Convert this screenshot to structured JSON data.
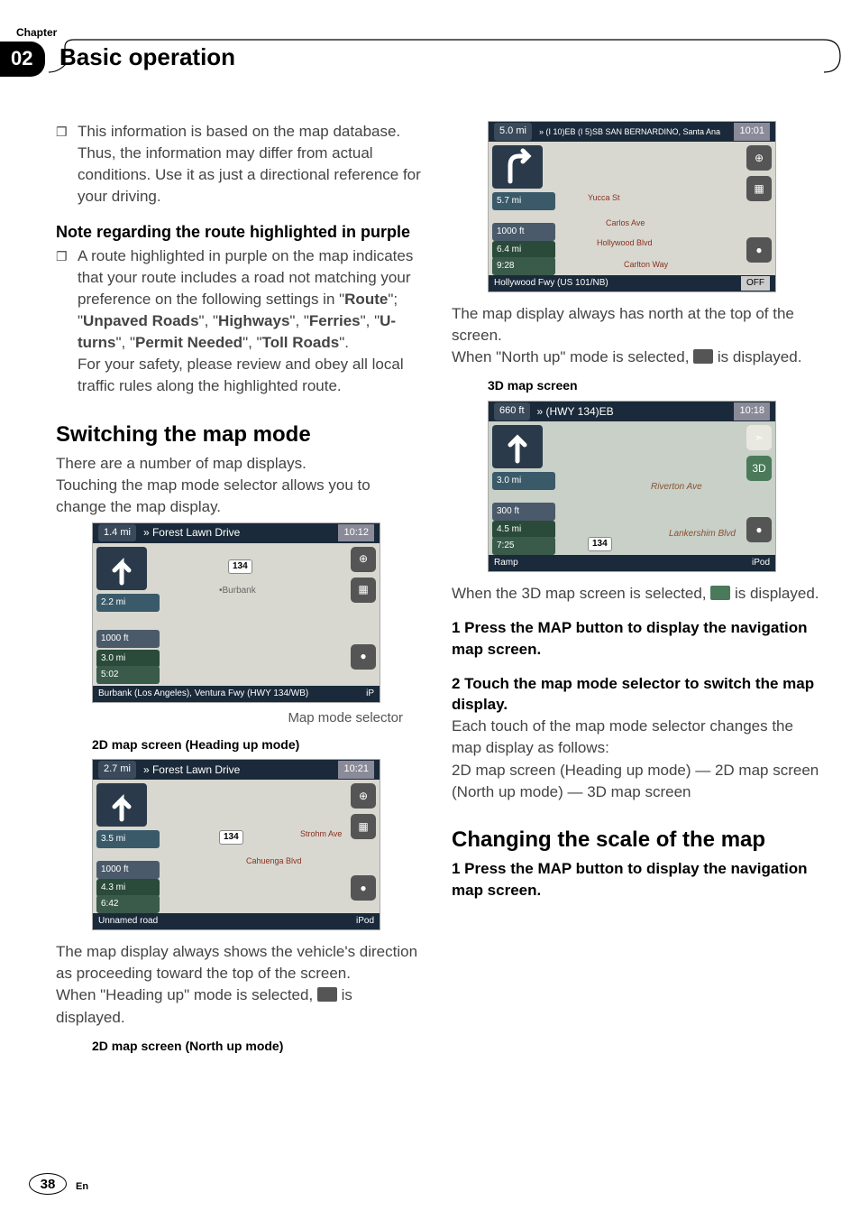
{
  "chapter_label": "Chapter",
  "chapter_num": "02",
  "chapter_title": "Basic operation",
  "bullet1": "This information is based on the map database. Thus, the information may differ from actual conditions. Use it as just a directional reference for your driving.",
  "subhead_purple": "Note regarding the route highlighted in purple",
  "bullet2_lead": "A route highlighted in purple on the map indicates that your route includes a road not matching your preference on the following settings in \"",
  "route_label": "Route",
  "mid_text": "\"; \"",
  "unpaved": "Unpaved Roads",
  "sep": "\", \"",
  "highways": "Highways",
  "ferries": "Ferries",
  "uturns": "U-turns",
  "permit": "Permit Needed",
  "toll": "Toll Roads",
  "end_quote": "\".",
  "safety": "For your safety, please review and obey all local traffic rules along the highlighted route.",
  "h2_switch": "Switching the map mode",
  "switch_p1": "There are a number of map displays.",
  "switch_p2": "Touching the map mode selector allows you to change the map display.",
  "map_mode_selector_caption": "Map mode selector",
  "caption_2d_heading": "2D map screen (Heading up mode)",
  "heading_up_desc": "The map display always shows the vehicle's direction as proceeding toward the top of the screen.",
  "heading_up_icon_pre": "When \"Heading up\" mode is selected, ",
  "heading_up_icon_post": " is displayed.",
  "caption_2d_north": "2D map screen (North up mode)",
  "north_up_desc": "The map display always has north at the top of the screen.",
  "north_up_icon_pre": "When \"North up\" mode is selected, ",
  "north_up_icon_post": " is displayed.",
  "caption_3d": "3D map screen",
  "threed_pre": "When the 3D map screen is selected, ",
  "threed_post": " is displayed.",
  "step1": "1    Press the MAP button to display the navigation map screen.",
  "step2": "2    Touch the map mode selector to switch the map display.",
  "step2_desc1": "Each touch of the map mode selector changes the map display as follows:",
  "step2_desc2": "2D map screen (Heading up mode) — 2D map screen (North up mode) — 3D map screen",
  "h2_scale": "Changing the scale of the map",
  "scale_step1": "1    Press the MAP button to display the navigation map screen.",
  "page_num": "38",
  "lang": "En",
  "ss1": {
    "dist": "1.4 mi",
    "road": "» Forest Lawn Drive",
    "time": "10:12",
    "side1": "2.2 mi",
    "side2": "1000 ft",
    "side3": "3.0 mi",
    "side4": "5:02",
    "bottom": "Burbank (Los Angeles), Ventura Fwy (HWY 134/WB)",
    "right_lbl": "iP",
    "shield": "134",
    "label_burbank": "•Burbank"
  },
  "ss2": {
    "dist": "2.7 mi",
    "road": "» Forest Lawn Drive",
    "time": "10:21",
    "side1": "3.5 mi",
    "side2": "1000 ft",
    "side3": "4.3 mi",
    "side4": "6:42",
    "bottom": "Unnamed road",
    "right_lbl": "iPod",
    "shield": "134",
    "st1": "Cahuenga Blvd",
    "st2": "Strohm Ave"
  },
  "ss3": {
    "dist": "5.0 mi",
    "road": "» (I 10)EB (I 5)SB SAN BERNARDINO, Santa Ana",
    "time": "10:01",
    "side1": "5.7 mi",
    "side2": "1000 ft",
    "side3": "6.4 mi",
    "side4": "9:28",
    "bottom": "Hollywood Fwy (US 101/NB)",
    "right_lbl": "OFF",
    "st1": "Yucca St",
    "st2": "Carlos Ave",
    "st3": "Hollywood Blvd",
    "st4": "Carlton Way"
  },
  "ss4": {
    "dist": "660 ft",
    "road": "» (HWY 134)EB",
    "time": "10:18",
    "side1": "3.0 mi",
    "side2": "300 ft",
    "side3": "4.5 mi",
    "side4": "7:25",
    "bottom": "Ramp",
    "right_lbl": "iPod",
    "shield": "134",
    "st1": "Riverton Ave",
    "st2": "Lankershim Blvd"
  }
}
